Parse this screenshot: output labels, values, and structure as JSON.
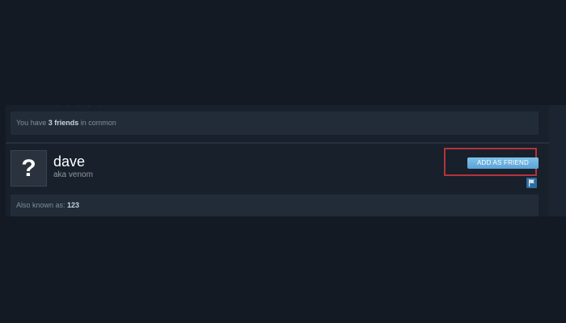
{
  "common": {
    "prefix": "You have ",
    "count_label": "3 friends",
    "suffix": " in common"
  },
  "profile": {
    "avatar_glyph": "?",
    "persona_name": "dave",
    "aka": "aka venom",
    "add_friend_label": "ADD AS FRIEND"
  },
  "aliases": {
    "label": "Also known as: ",
    "value": "123"
  },
  "icons": {
    "avatar": "question-mark-avatar-icon",
    "report": "flag-icon"
  },
  "colors": {
    "background": "#131a23",
    "panel": "#18202b",
    "box": "#222c38",
    "button": "#67b3e4",
    "highlight": "#b3333b",
    "flag": "#2e6ea0"
  }
}
